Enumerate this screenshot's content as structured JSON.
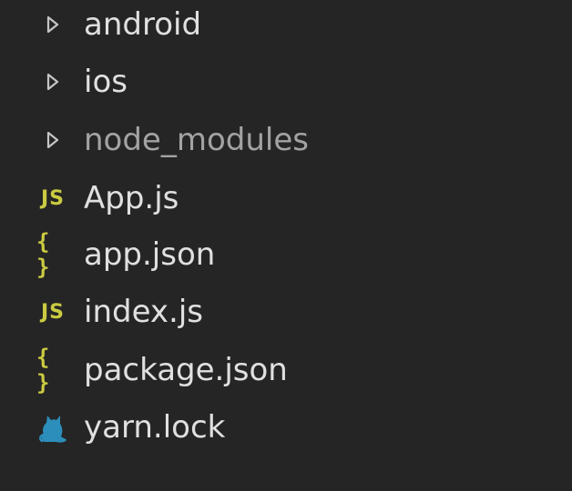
{
  "tree": {
    "items": [
      {
        "label": "android",
        "kind": "folder",
        "icon": "chevron-right-icon",
        "dimmed": false
      },
      {
        "label": "ios",
        "kind": "folder",
        "icon": "chevron-right-icon",
        "dimmed": false
      },
      {
        "label": "node_modules",
        "kind": "folder",
        "icon": "chevron-right-icon",
        "dimmed": true
      },
      {
        "label": "App.js",
        "kind": "file",
        "icon": "javascript-file-icon",
        "icon_text": "JS"
      },
      {
        "label": "app.json",
        "kind": "file",
        "icon": "json-file-icon",
        "icon_text": "{ }"
      },
      {
        "label": "index.js",
        "kind": "file",
        "icon": "javascript-file-icon",
        "icon_text": "JS"
      },
      {
        "label": "package.json",
        "kind": "file",
        "icon": "json-file-icon",
        "icon_text": "{ }"
      },
      {
        "label": "yarn.lock",
        "kind": "file",
        "icon": "yarn-cat-icon"
      }
    ]
  },
  "colors": {
    "background": "#252526",
    "text": "#e0e0e0",
    "dimmed_text": "#a3a3a3",
    "js_icon": "#cbcb41",
    "json_icon": "#cbcb41",
    "yarn_icon": "#2c8ebb",
    "chevron": "#c5c5c5"
  }
}
